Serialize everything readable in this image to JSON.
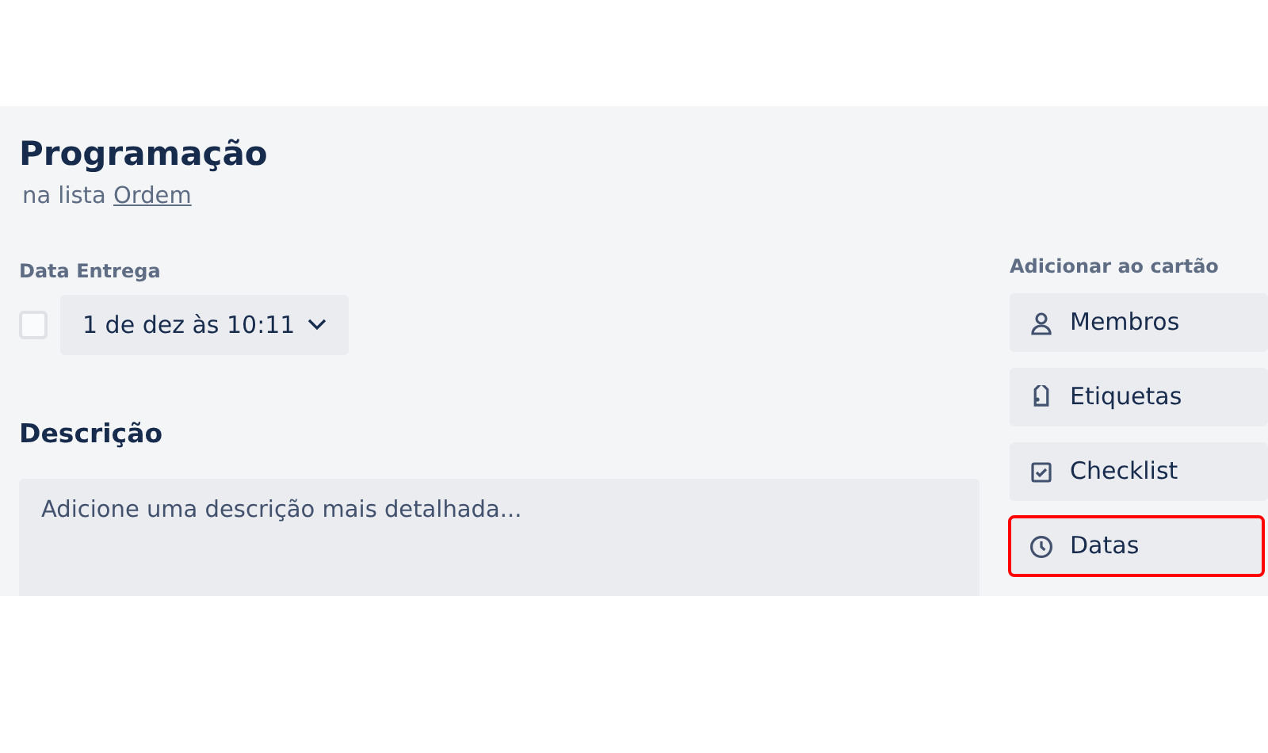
{
  "card": {
    "title": "Programação",
    "list_prefix": "na lista",
    "list_link": "Ordem"
  },
  "due_date": {
    "label": "Data Entrega",
    "checked": false,
    "value": "1 de dez às 10:11"
  },
  "description": {
    "heading": "Descrição",
    "placeholder": "Adicione uma descrição mais detalhada..."
  },
  "sidebar": {
    "heading": "Adicionar ao cartão",
    "buttons": [
      {
        "label": "Membros",
        "kind": "members",
        "highlighted": false
      },
      {
        "label": "Etiquetas",
        "kind": "labels",
        "highlighted": false
      },
      {
        "label": "Checklist",
        "kind": "checklist",
        "highlighted": false
      },
      {
        "label": "Datas",
        "kind": "dates",
        "highlighted": true
      }
    ]
  }
}
